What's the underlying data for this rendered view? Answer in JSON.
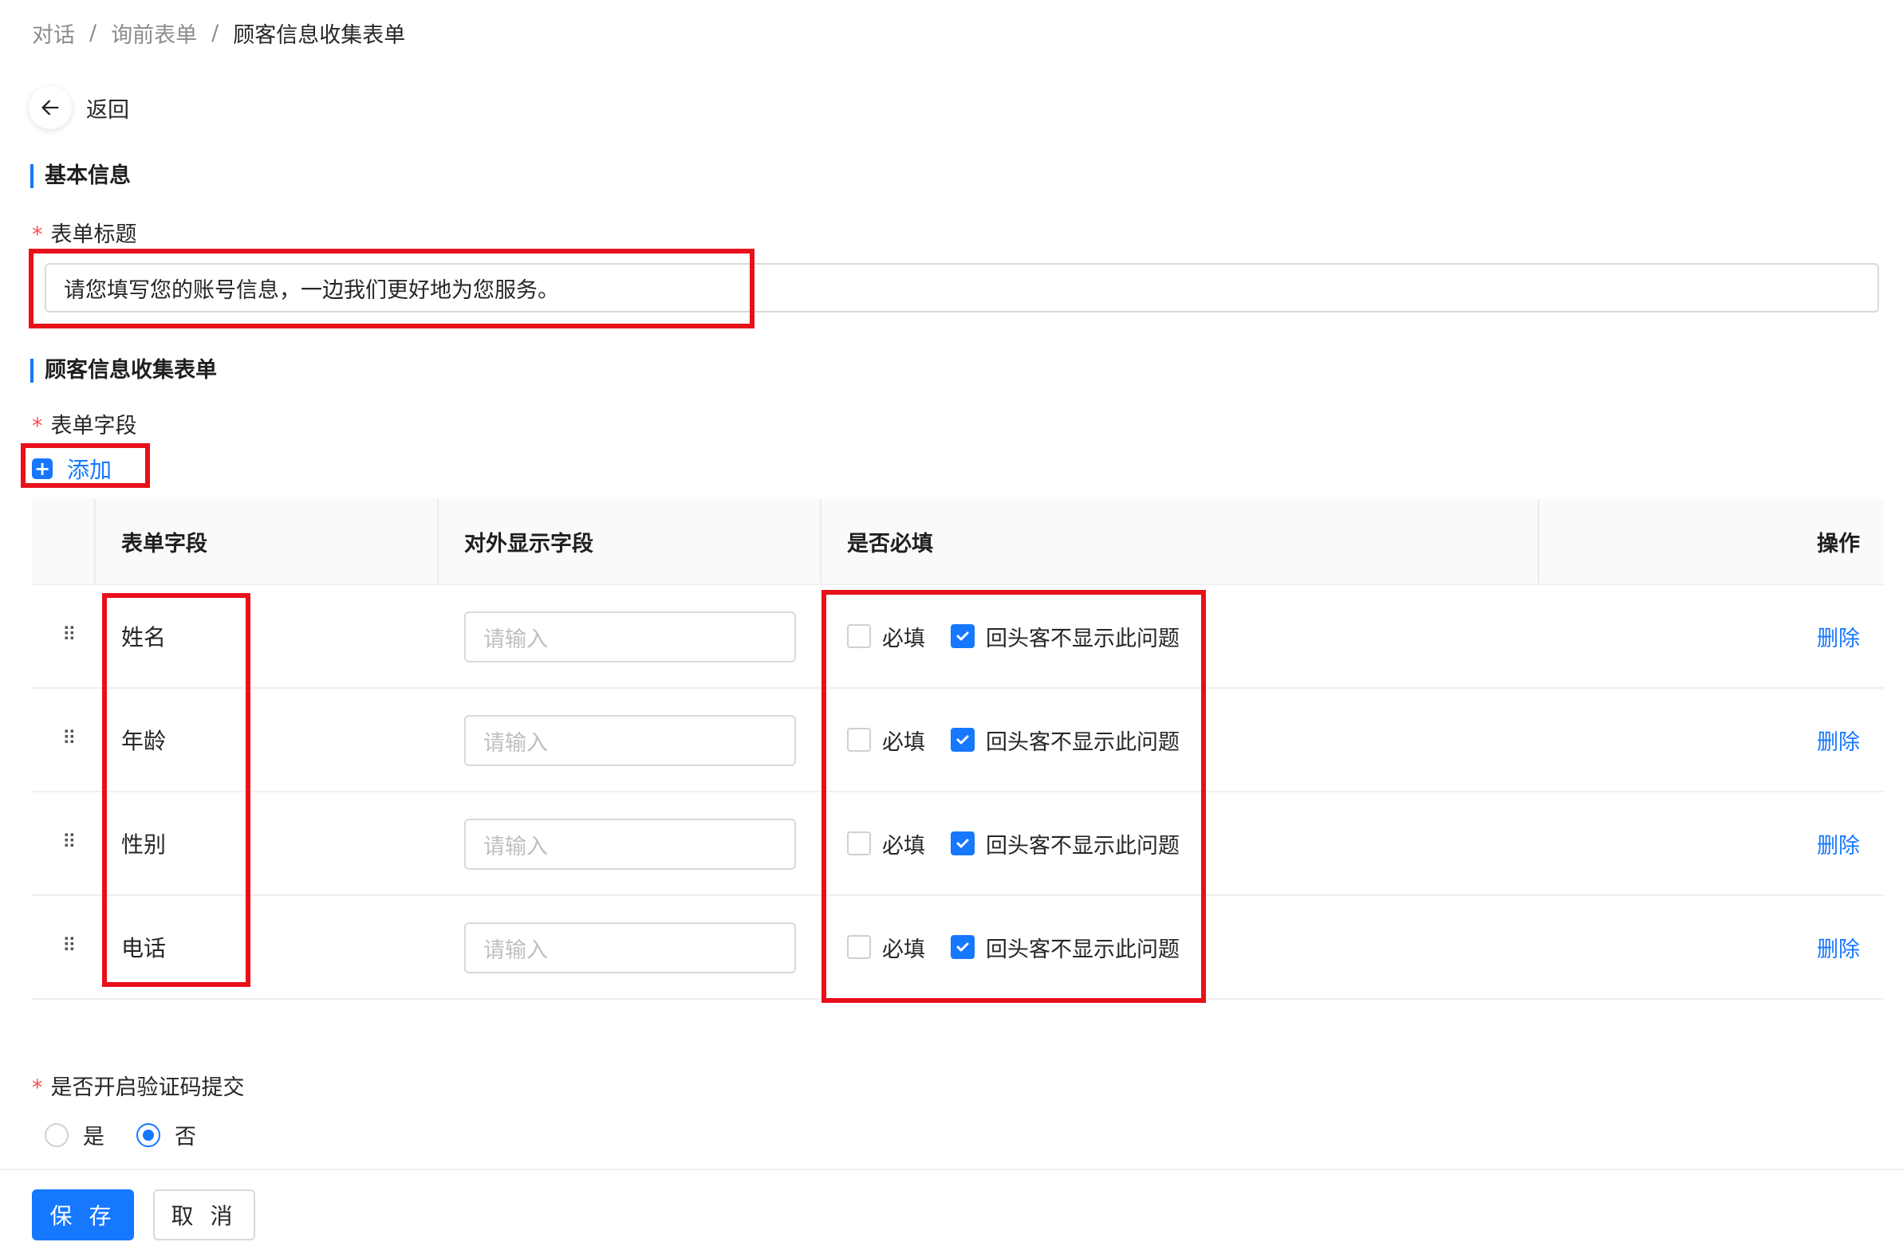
{
  "breadcrumb": [
    "对话",
    "询前表单",
    "顾客信息收集表单"
  ],
  "breadcrumb_separator": "/",
  "back": {
    "label": "返回"
  },
  "basic_section": {
    "title": "基本信息",
    "form_title_label": "表单标题",
    "form_title_value": "请您填写您的账号信息，一边我们更好地为您服务。"
  },
  "collect_section": {
    "title": "顾客信息收集表单",
    "fields_label": "表单字段",
    "add_label": "添加"
  },
  "table": {
    "headers": [
      "表单字段",
      "对外显示字段",
      "是否必填",
      "操作"
    ],
    "rows": [
      {
        "field": "姓名",
        "display_placeholder": "请输入",
        "required_label": "必填",
        "required": false,
        "hide_returning_label": "回头客不显示此问题",
        "hide_returning": true,
        "action": "删除"
      },
      {
        "field": "年龄",
        "display_placeholder": "请输入",
        "required_label": "必填",
        "required": false,
        "hide_returning_label": "回头客不显示此问题",
        "hide_returning": true,
        "action": "删除"
      },
      {
        "field": "性别",
        "display_placeholder": "请输入",
        "required_label": "必填",
        "required": false,
        "hide_returning_label": "回头客不显示此问题",
        "hide_returning": true,
        "action": "删除"
      },
      {
        "field": "电话",
        "display_placeholder": "请输入",
        "required_label": "必填",
        "required": false,
        "hide_returning_label": "回头客不显示此问题",
        "hide_returning": true,
        "action": "删除"
      }
    ]
  },
  "captcha": {
    "label": "是否开启验证码提交",
    "options": [
      "是",
      "否"
    ],
    "selected": "否"
  },
  "footer": {
    "save": "保 存",
    "cancel": "取 消"
  },
  "colors": {
    "primary": "#1677ff",
    "required": "#ff4d4f",
    "highlight": "#e8101a"
  }
}
